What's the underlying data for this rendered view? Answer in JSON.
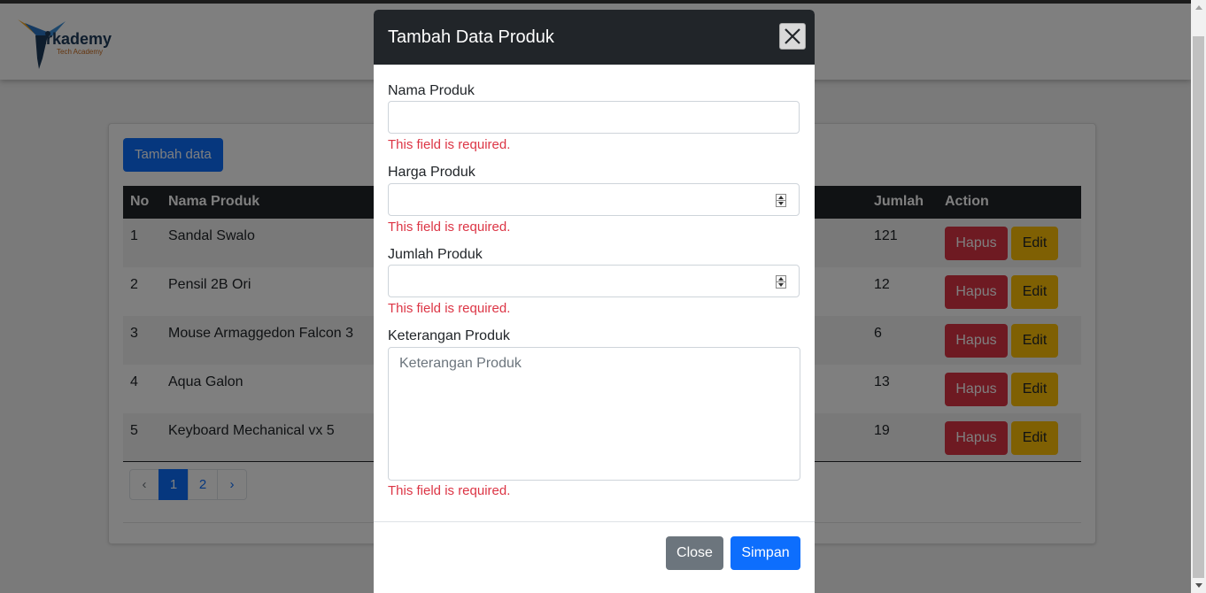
{
  "brand": {
    "name": "arkademy",
    "tagline": "Tech Academy"
  },
  "card": {
    "add_button": "Tambah data"
  },
  "table": {
    "headers": {
      "no": "No",
      "name": "Nama Produk",
      "qty": "Jumlah",
      "action": "Action"
    },
    "rows": [
      {
        "no": "1",
        "name": "Sandal Swalo",
        "qty": "121"
      },
      {
        "no": "2",
        "name": "Pensil 2B Ori",
        "qty": "12"
      },
      {
        "no": "3",
        "name": "Mouse Armaggedon Falcon 3",
        "qty": "6"
      },
      {
        "no": "4",
        "name": "Aqua Galon",
        "qty": "13"
      },
      {
        "no": "5",
        "name": "Keyboard Mechanical vx 5",
        "qty": "19"
      }
    ],
    "delete_label": "Hapus",
    "edit_label": "Edit"
  },
  "pagination": {
    "prev": "‹",
    "pages": [
      "1",
      "2"
    ],
    "next": "›",
    "active_page": "1"
  },
  "modal": {
    "title": "Tambah Data Produk",
    "fields": {
      "name_label": "Nama Produk",
      "price_label": "Harga Produk",
      "qty_label": "Jumlah Produk",
      "desc_label": "Keterangan Produk",
      "desc_placeholder": "Keterangan Produk"
    },
    "error_text": "This field is required.",
    "close_label": "Close",
    "save_label": "Simpan"
  }
}
